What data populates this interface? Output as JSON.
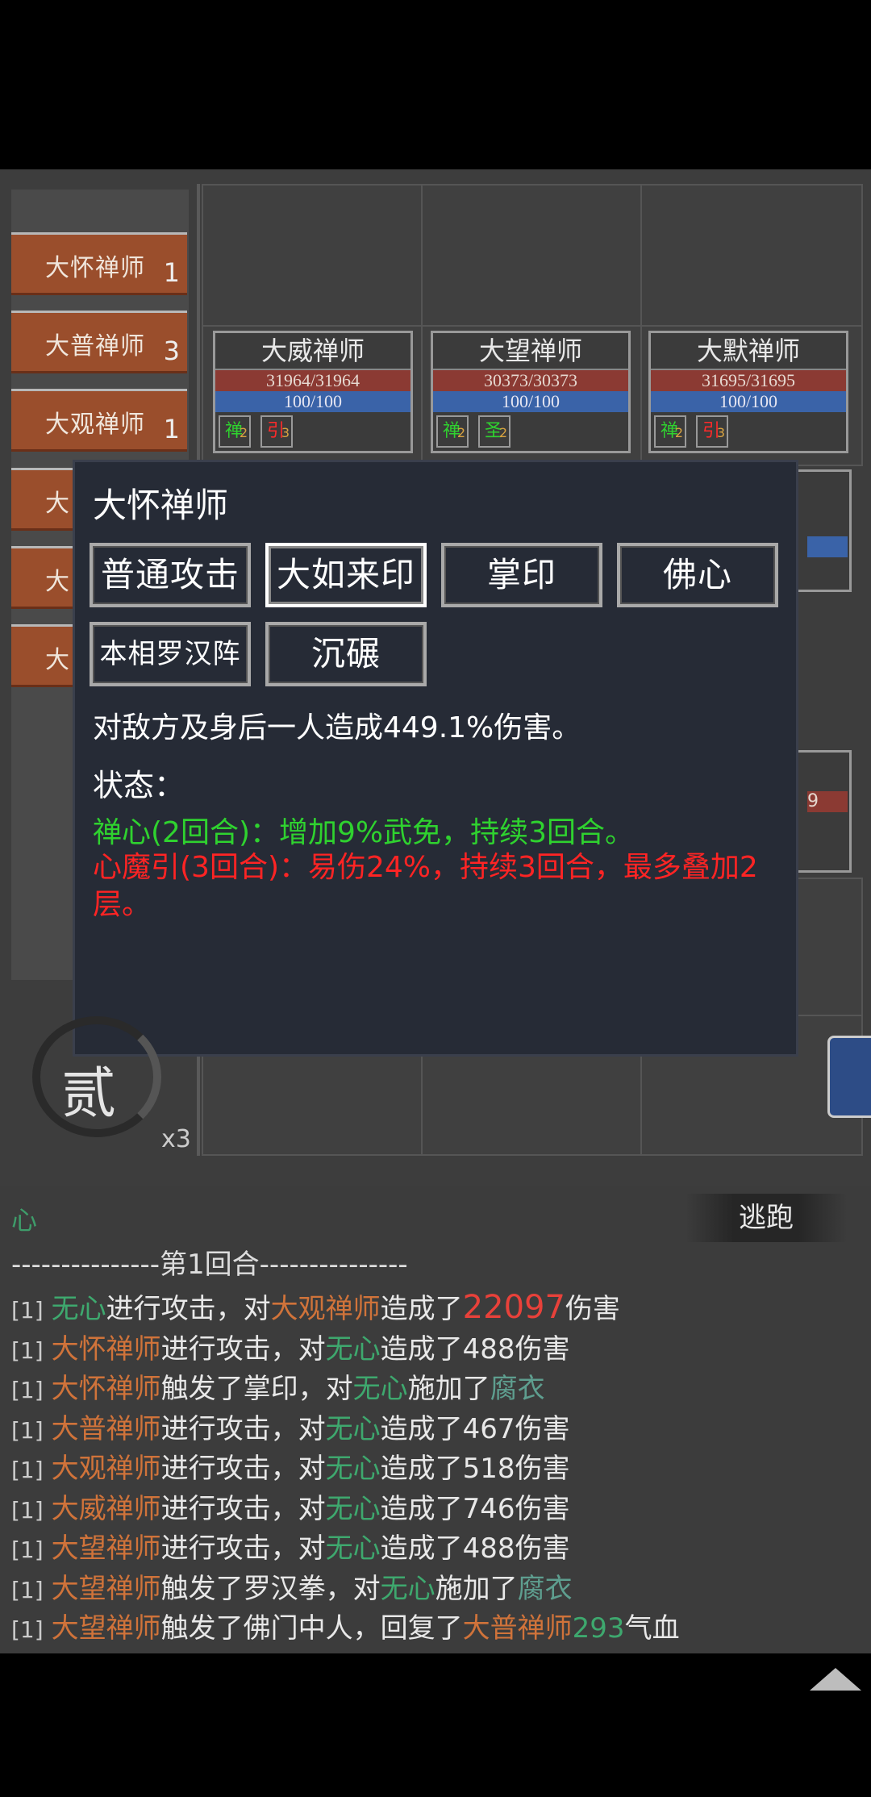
{
  "enemy_list": [
    {
      "name": "大怀禅师",
      "count": "1"
    },
    {
      "name": "大普禅师",
      "count": "3"
    },
    {
      "name": "大观禅师",
      "count": "1"
    },
    {
      "name": "大",
      "count": ""
    },
    {
      "name": "大",
      "count": ""
    },
    {
      "name": "大",
      "count": ""
    }
  ],
  "unit_cards": [
    {
      "name": "大威禅师",
      "hp": "31964/31964",
      "mp": "100/100",
      "tags": [
        {
          "glyph": "禅",
          "n": "2",
          "color": "#2fd22f"
        },
        {
          "glyph": "引",
          "n": "3",
          "color": "#ff2a2a"
        }
      ]
    },
    {
      "name": "大望禅师",
      "hp": "30373/30373",
      "mp": "100/100",
      "tags": [
        {
          "glyph": "禅",
          "n": "2",
          "color": "#2fd22f"
        },
        {
          "glyph": "圣",
          "n": "2",
          "color": "#2fd22f"
        }
      ]
    },
    {
      "name": "大默禅师",
      "hp": "31695/31695",
      "mp": "100/100",
      "tags": [
        {
          "glyph": "禅",
          "n": "2",
          "color": "#2fd22f"
        },
        {
          "glyph": "引",
          "n": "3",
          "color": "#ff2a2a"
        }
      ]
    }
  ],
  "partial_value": "9",
  "popup": {
    "title": "大怀禅师",
    "skills": [
      "普通攻击",
      "大如来印",
      "掌印",
      "佛心",
      "本相罗汉阵",
      "沉碾"
    ],
    "selected_skill": "大如来印",
    "description": "对敌方及身后一人造成449.1%伤害。",
    "status_label": "状态：",
    "status_1": "禅心(2回合)：增加9%武免，持续3回合。",
    "status_2": "心魔引(3回合)：易伤24%，持续3回合，最多叠加2层。"
  },
  "round_badge": {
    "glyph": "贰",
    "multiplier": "x3"
  },
  "flee_label": "逃跑",
  "log": {
    "cut_top_text": "心",
    "round_divider": "---------------第1回合---------------",
    "lines": [
      {
        "idx": "[1]",
        "segs": [
          [
            "无心",
            "g"
          ],
          [
            "进行攻击，对",
            ""
          ],
          [
            "大观禅师",
            "o"
          ],
          [
            "造成了",
            ""
          ],
          [
            "22097",
            "r"
          ],
          [
            "伤害",
            ""
          ]
        ]
      },
      {
        "idx": "[1]",
        "segs": [
          [
            "大怀禅师",
            "o"
          ],
          [
            "进行攻击，对",
            ""
          ],
          [
            "无心",
            "g"
          ],
          [
            "造成了488伤害",
            ""
          ]
        ]
      },
      {
        "idx": "[1]",
        "segs": [
          [
            "大怀禅师",
            "o"
          ],
          [
            "触发了掌印，对",
            ""
          ],
          [
            "无心",
            "g"
          ],
          [
            "施加了",
            ""
          ],
          [
            "腐衣",
            "t"
          ]
        ]
      },
      {
        "idx": "[1]",
        "segs": [
          [
            "大普禅师",
            "o"
          ],
          [
            "进行攻击，对",
            ""
          ],
          [
            "无心",
            "g"
          ],
          [
            "造成了467伤害",
            ""
          ]
        ]
      },
      {
        "idx": "[1]",
        "segs": [
          [
            "大观禅师",
            "o"
          ],
          [
            "进行攻击，对",
            ""
          ],
          [
            "无心",
            "g"
          ],
          [
            "造成了518伤害",
            ""
          ]
        ]
      },
      {
        "idx": "[1]",
        "segs": [
          [
            "大威禅师",
            "o"
          ],
          [
            "进行攻击，对",
            ""
          ],
          [
            "无心",
            "g"
          ],
          [
            "造成了746伤害",
            ""
          ]
        ]
      },
      {
        "idx": "[1]",
        "segs": [
          [
            "大望禅师",
            "o"
          ],
          [
            "进行攻击，对",
            ""
          ],
          [
            "无心",
            "g"
          ],
          [
            "造成了488伤害",
            ""
          ]
        ]
      },
      {
        "idx": "[1]",
        "segs": [
          [
            "大望禅师",
            "o"
          ],
          [
            "触发了罗汉拳，对",
            ""
          ],
          [
            "无心",
            "g"
          ],
          [
            "施加了",
            ""
          ],
          [
            "腐衣",
            "t"
          ]
        ]
      },
      {
        "idx": "[1]",
        "segs": [
          [
            "大望禅师",
            "o"
          ],
          [
            "触发了佛门中人，回复了",
            ""
          ],
          [
            "大普禅师",
            "o"
          ],
          [
            "293",
            "g"
          ],
          [
            "气血",
            ""
          ]
        ]
      }
    ]
  },
  "colors": {
    "hp_bar": "#8b3a33",
    "mp_bar": "#3a63a8",
    "enemy_tab": "#9a4e2c",
    "popup_bg": "#262b36"
  }
}
